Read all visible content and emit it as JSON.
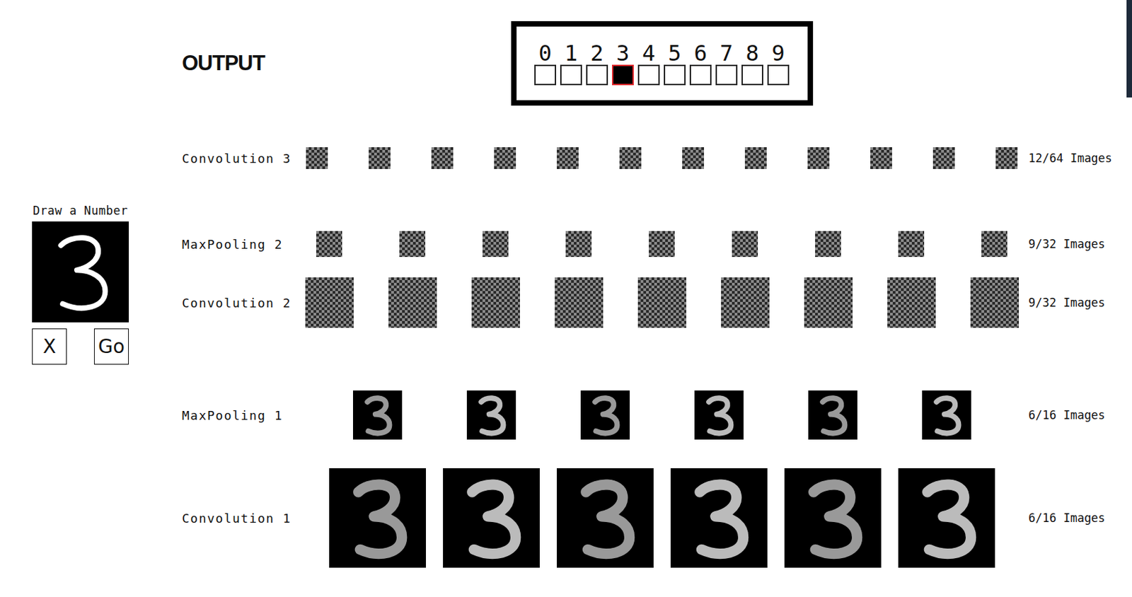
{
  "output": {
    "title": "OUTPUT",
    "digits": [
      {
        "label": "0",
        "selected": false
      },
      {
        "label": "1",
        "selected": false
      },
      {
        "label": "2",
        "selected": false
      },
      {
        "label": "3",
        "selected": true
      },
      {
        "label": "4",
        "selected": false
      },
      {
        "label": "5",
        "selected": false
      },
      {
        "label": "6",
        "selected": false
      },
      {
        "label": "7",
        "selected": false
      },
      {
        "label": "8",
        "selected": false
      },
      {
        "label": "9",
        "selected": false
      }
    ]
  },
  "draw_panel": {
    "title": "Draw a Number",
    "buttons": [
      "X",
      "Go"
    ]
  },
  "layers": [
    {
      "label": "Convolution 3",
      "count": "12/64 Images",
      "tiles": 12,
      "kind": "noise"
    },
    {
      "label": "MaxPooling 2",
      "count": "9/32 Images",
      "tiles": 9,
      "kind": "noise"
    },
    {
      "label": "Convolution 2",
      "count": "9/32 Images",
      "tiles": 9,
      "kind": "noise"
    },
    {
      "label": "MaxPooling 1",
      "count": "6/16 Images",
      "tiles": 6,
      "kind": "digit"
    },
    {
      "label": "Convolution 1",
      "count": "6/16 Images",
      "tiles": 6,
      "kind": "digit"
    }
  ]
}
